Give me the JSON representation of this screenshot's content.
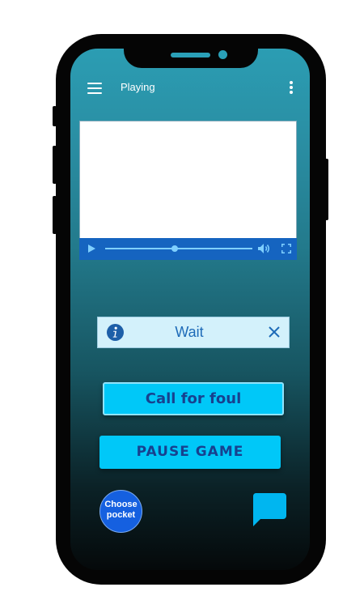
{
  "header": {
    "title": "Playing"
  },
  "video": {
    "progress": 0.47
  },
  "alert": {
    "text": "Wait"
  },
  "buttons": {
    "call_foul": "Call for foul",
    "pause": "PAUSE GAME",
    "pocket_line1": "Choose",
    "pocket_line2": "pocket"
  },
  "icons": {
    "menu": "hamburger-menu-icon",
    "more": "more-vertical-icon",
    "play": "play-icon",
    "volume": "volume-icon",
    "fullscreen": "fullscreen-icon",
    "info": "info-icon",
    "close": "close-icon",
    "chat": "chat-icon"
  },
  "colors": {
    "accent": "#00c8f8",
    "button_text": "#17418f",
    "pocket": "#1560e0",
    "alert_bg": "#d3f1fb",
    "chat": "#00b6f0"
  }
}
